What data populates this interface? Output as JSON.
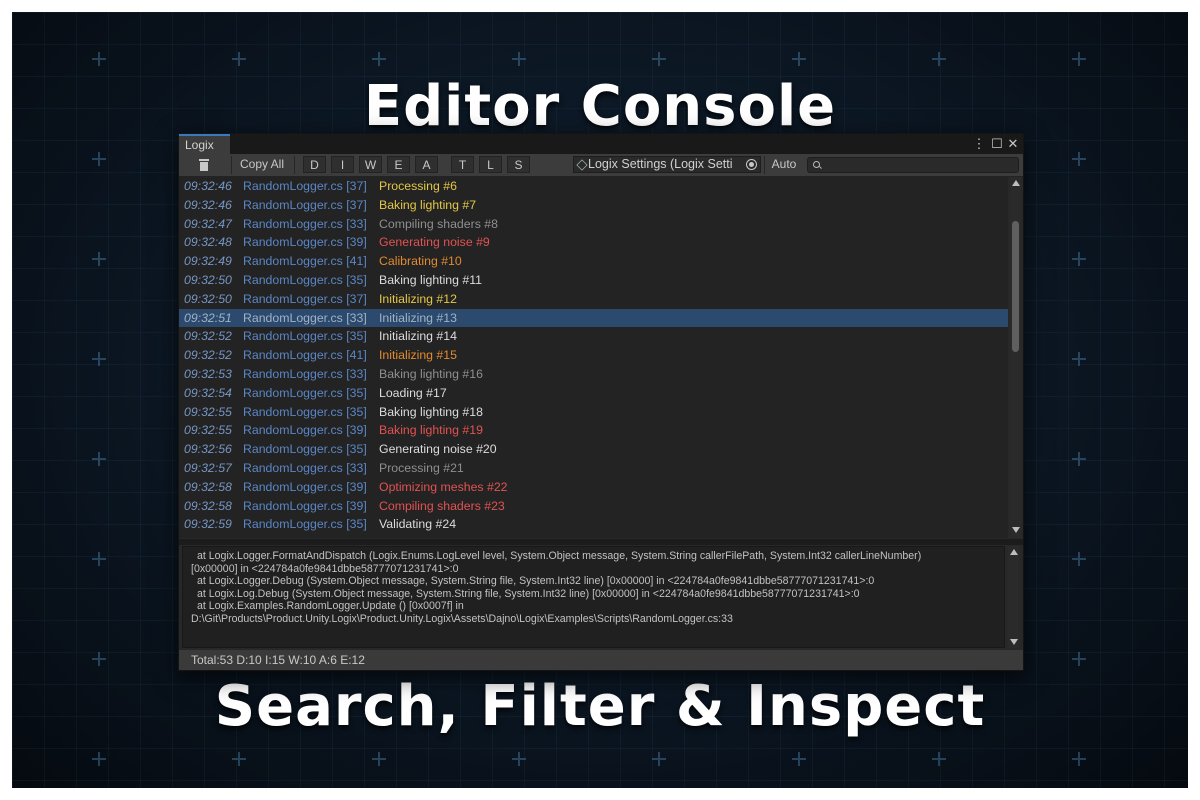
{
  "headline_top": "Editor Console",
  "headline_bottom": "Search, Filter & Inspect",
  "window": {
    "tab_title": "Logix",
    "toolbar": {
      "copy_all": "Copy All",
      "filters": [
        "D",
        "I",
        "W",
        "E",
        "A",
        "T",
        "L",
        "S"
      ],
      "settings_field": "Logix Settings (Logix Setti",
      "auto": "Auto",
      "search_value": ""
    },
    "log_rows": [
      {
        "time": "09:32:46",
        "file": "RandomLogger.cs [37]",
        "msg": "Processing #6",
        "level": "warn"
      },
      {
        "time": "09:32:46",
        "file": "RandomLogger.cs [37]",
        "msg": "Baking lighting #7",
        "level": "warn"
      },
      {
        "time": "09:32:47",
        "file": "RandomLogger.cs [33]",
        "msg": "Compiling shaders #8",
        "level": "debug"
      },
      {
        "time": "09:32:48",
        "file": "RandomLogger.cs [39]",
        "msg": "Generating noise #9",
        "level": "error"
      },
      {
        "time": "09:32:49",
        "file": "RandomLogger.cs [41]",
        "msg": "Calibrating #10",
        "level": "alert"
      },
      {
        "time": "09:32:50",
        "file": "RandomLogger.cs [35]",
        "msg": "Baking lighting #11",
        "level": "info"
      },
      {
        "time": "09:32:50",
        "file": "RandomLogger.cs [37]",
        "msg": "Initializing #12",
        "level": "warn"
      },
      {
        "time": "09:32:51",
        "file": "RandomLogger.cs [33]",
        "msg": "Initializing #13",
        "level": "debug",
        "selected": true
      },
      {
        "time": "09:32:52",
        "file": "RandomLogger.cs [35]",
        "msg": "Initializing #14",
        "level": "info"
      },
      {
        "time": "09:32:52",
        "file": "RandomLogger.cs [41]",
        "msg": "Initializing #15",
        "level": "alert"
      },
      {
        "time": "09:32:53",
        "file": "RandomLogger.cs [33]",
        "msg": "Baking lighting #16",
        "level": "debug"
      },
      {
        "time": "09:32:54",
        "file": "RandomLogger.cs [35]",
        "msg": "Loading #17",
        "level": "info"
      },
      {
        "time": "09:32:55",
        "file": "RandomLogger.cs [35]",
        "msg": "Baking lighting #18",
        "level": "info"
      },
      {
        "time": "09:32:55",
        "file": "RandomLogger.cs [39]",
        "msg": "Baking lighting #19",
        "level": "error"
      },
      {
        "time": "09:32:56",
        "file": "RandomLogger.cs [35]",
        "msg": "Generating noise #20",
        "level": "info"
      },
      {
        "time": "09:32:57",
        "file": "RandomLogger.cs [33]",
        "msg": "Processing #21",
        "level": "debug"
      },
      {
        "time": "09:32:58",
        "file": "RandomLogger.cs [39]",
        "msg": "Optimizing meshes #22",
        "level": "error"
      },
      {
        "time": "09:32:58",
        "file": "RandomLogger.cs [39]",
        "msg": "Compiling shaders #23",
        "level": "error"
      },
      {
        "time": "09:32:59",
        "file": "RandomLogger.cs [35]",
        "msg": "Validating #24",
        "level": "info"
      }
    ],
    "level_colors": {
      "debug": "#8f8f8f",
      "info": "#dcdcdc",
      "warn": "#e3c746",
      "alert": "#e28a2e",
      "error": "#e25252",
      "time": "#7596c4",
      "file": "#5b86c5",
      "selection": "#2c4a6e"
    },
    "stack_trace": [
      "at Logix.Logger.FormatAndDispatch (Logix.Enums.LogLevel level, System.Object message, System.String callerFilePath, System.Int32 callerLineNumber)",
      "[0x00000] in <224784a0fe9841dbbe58777071231741>:0",
      "at Logix.Logger.Debug (System.Object message, System.String file, System.Int32 line) [0x00000] in <224784a0fe9841dbbe58777071231741>:0",
      "at Logix.Log.Debug (System.Object message, System.String file, System.Int32 line) [0x00000] in <224784a0fe9841dbbe58777071231741>:0",
      "at Logix.Examples.RandomLogger.Update () [0x0007f] in",
      "D:\\Git\\Products\\Product.Unity.Logix\\Product.Unity.Logix\\Assets\\Dajno\\Logix\\Examples\\Scripts\\RandomLogger.cs:33"
    ],
    "status": "Total:53 D:10 I:15 W:10 A:6 E:12"
  }
}
